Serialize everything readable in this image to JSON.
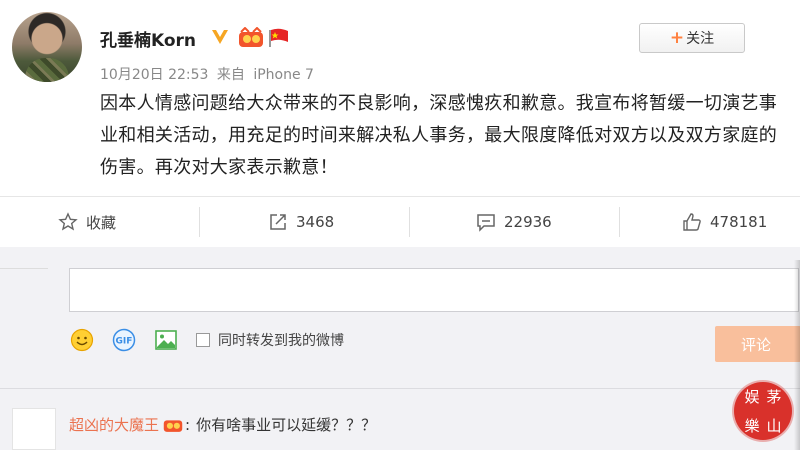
{
  "post": {
    "author": "孔垂楠Korn",
    "date": "10月20日 22:53",
    "source_prefix": "来自",
    "source": "iPhone 7",
    "follow_label": "关注",
    "content": "因本人情感问题给大众带来的不良影响，深感愧疚和歉意。我宣布将暂缓一切演艺事业和相关活动，用充足的时间来解决私人事务，最大限度降低对双方以及双方家庭的伤害。再次对大家表示歉意！"
  },
  "actions": {
    "favorite_label": "收藏",
    "repost_count": "3468",
    "comment_count": "22936",
    "like_count": "478181"
  },
  "comment_box": {
    "forward_label": "同时转发到我的微博",
    "submit_label": "评论",
    "gif_label": "GIF"
  },
  "reply": {
    "username": "超凶的大魔王",
    "separator": ":",
    "text": "你有啥事业可以延缓？？？"
  },
  "watermark": {
    "chars": [
      "娱",
      "茅",
      "樂",
      "山"
    ]
  },
  "colors": {
    "accent_orange": "#ff8140",
    "username_orange": "#eb7350",
    "submit_disabled": "#f9bf9c",
    "stamp_red": "#d9312b"
  },
  "icons": [
    "verified-icon",
    "member-badge-icon",
    "china-flag-icon",
    "star-icon",
    "repost-icon",
    "comment-icon",
    "like-icon",
    "emoji-icon",
    "gif-icon",
    "image-icon"
  ]
}
